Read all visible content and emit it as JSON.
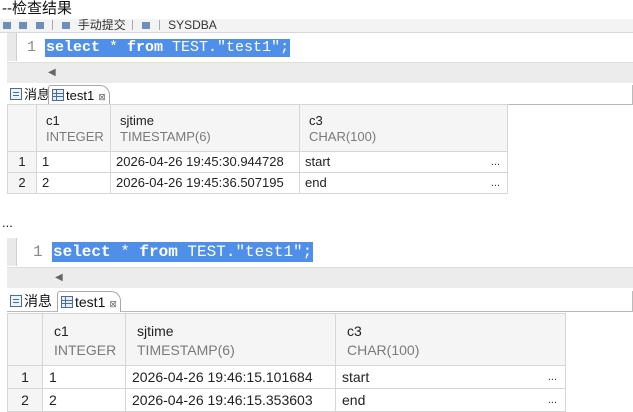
{
  "caption_top": "--检查结果",
  "caption_mid": "...",
  "toolbar": {
    "commit_mode": "手动提交",
    "schema": "SYSDBA"
  },
  "block1": {
    "line_number": "1",
    "sql": {
      "kw1": "select",
      "star": " * ",
      "kw2": "from",
      "rest": " TEST.\"test1\";"
    },
    "tabs": {
      "messages": "消息",
      "result": "test1",
      "close": "⊠"
    },
    "columns": [
      {
        "name": "c1",
        "type": "INTEGER"
      },
      {
        "name": "sjtime",
        "type": "TIMESTAMP(6)"
      },
      {
        "name": "c3",
        "type": "CHAR(100)"
      }
    ],
    "rows": [
      {
        "rn": "1",
        "c1": "1",
        "sjtime": "2026-04-26 19:45:30.944728",
        "c3": "start",
        "ell": "..."
      },
      {
        "rn": "2",
        "c1": "2",
        "sjtime": "2026-04-26 19:45:36.507195",
        "c3": "end",
        "ell": "..."
      }
    ]
  },
  "block2": {
    "line_number": "1",
    "sql": {
      "kw1": "select",
      "star": " * ",
      "kw2": "from",
      "rest": " TEST.\"test1\";"
    },
    "tabs": {
      "messages": "消息",
      "result": "test1",
      "close": "⊠"
    },
    "columns": [
      {
        "name": "c1",
        "type": "INTEGER"
      },
      {
        "name": "sjtime",
        "type": "TIMESTAMP(6)"
      },
      {
        "name": "c3",
        "type": "CHAR(100)"
      }
    ],
    "rows": [
      {
        "rn": "1",
        "c1": "1",
        "sjtime": "2026-04-26 19:46:15.101684",
        "c3": "start",
        "ell": "..."
      },
      {
        "rn": "2",
        "c1": "2",
        "sjtime": "2026-04-26 19:46:15.353603",
        "c3": "end",
        "ell": "..."
      }
    ]
  }
}
